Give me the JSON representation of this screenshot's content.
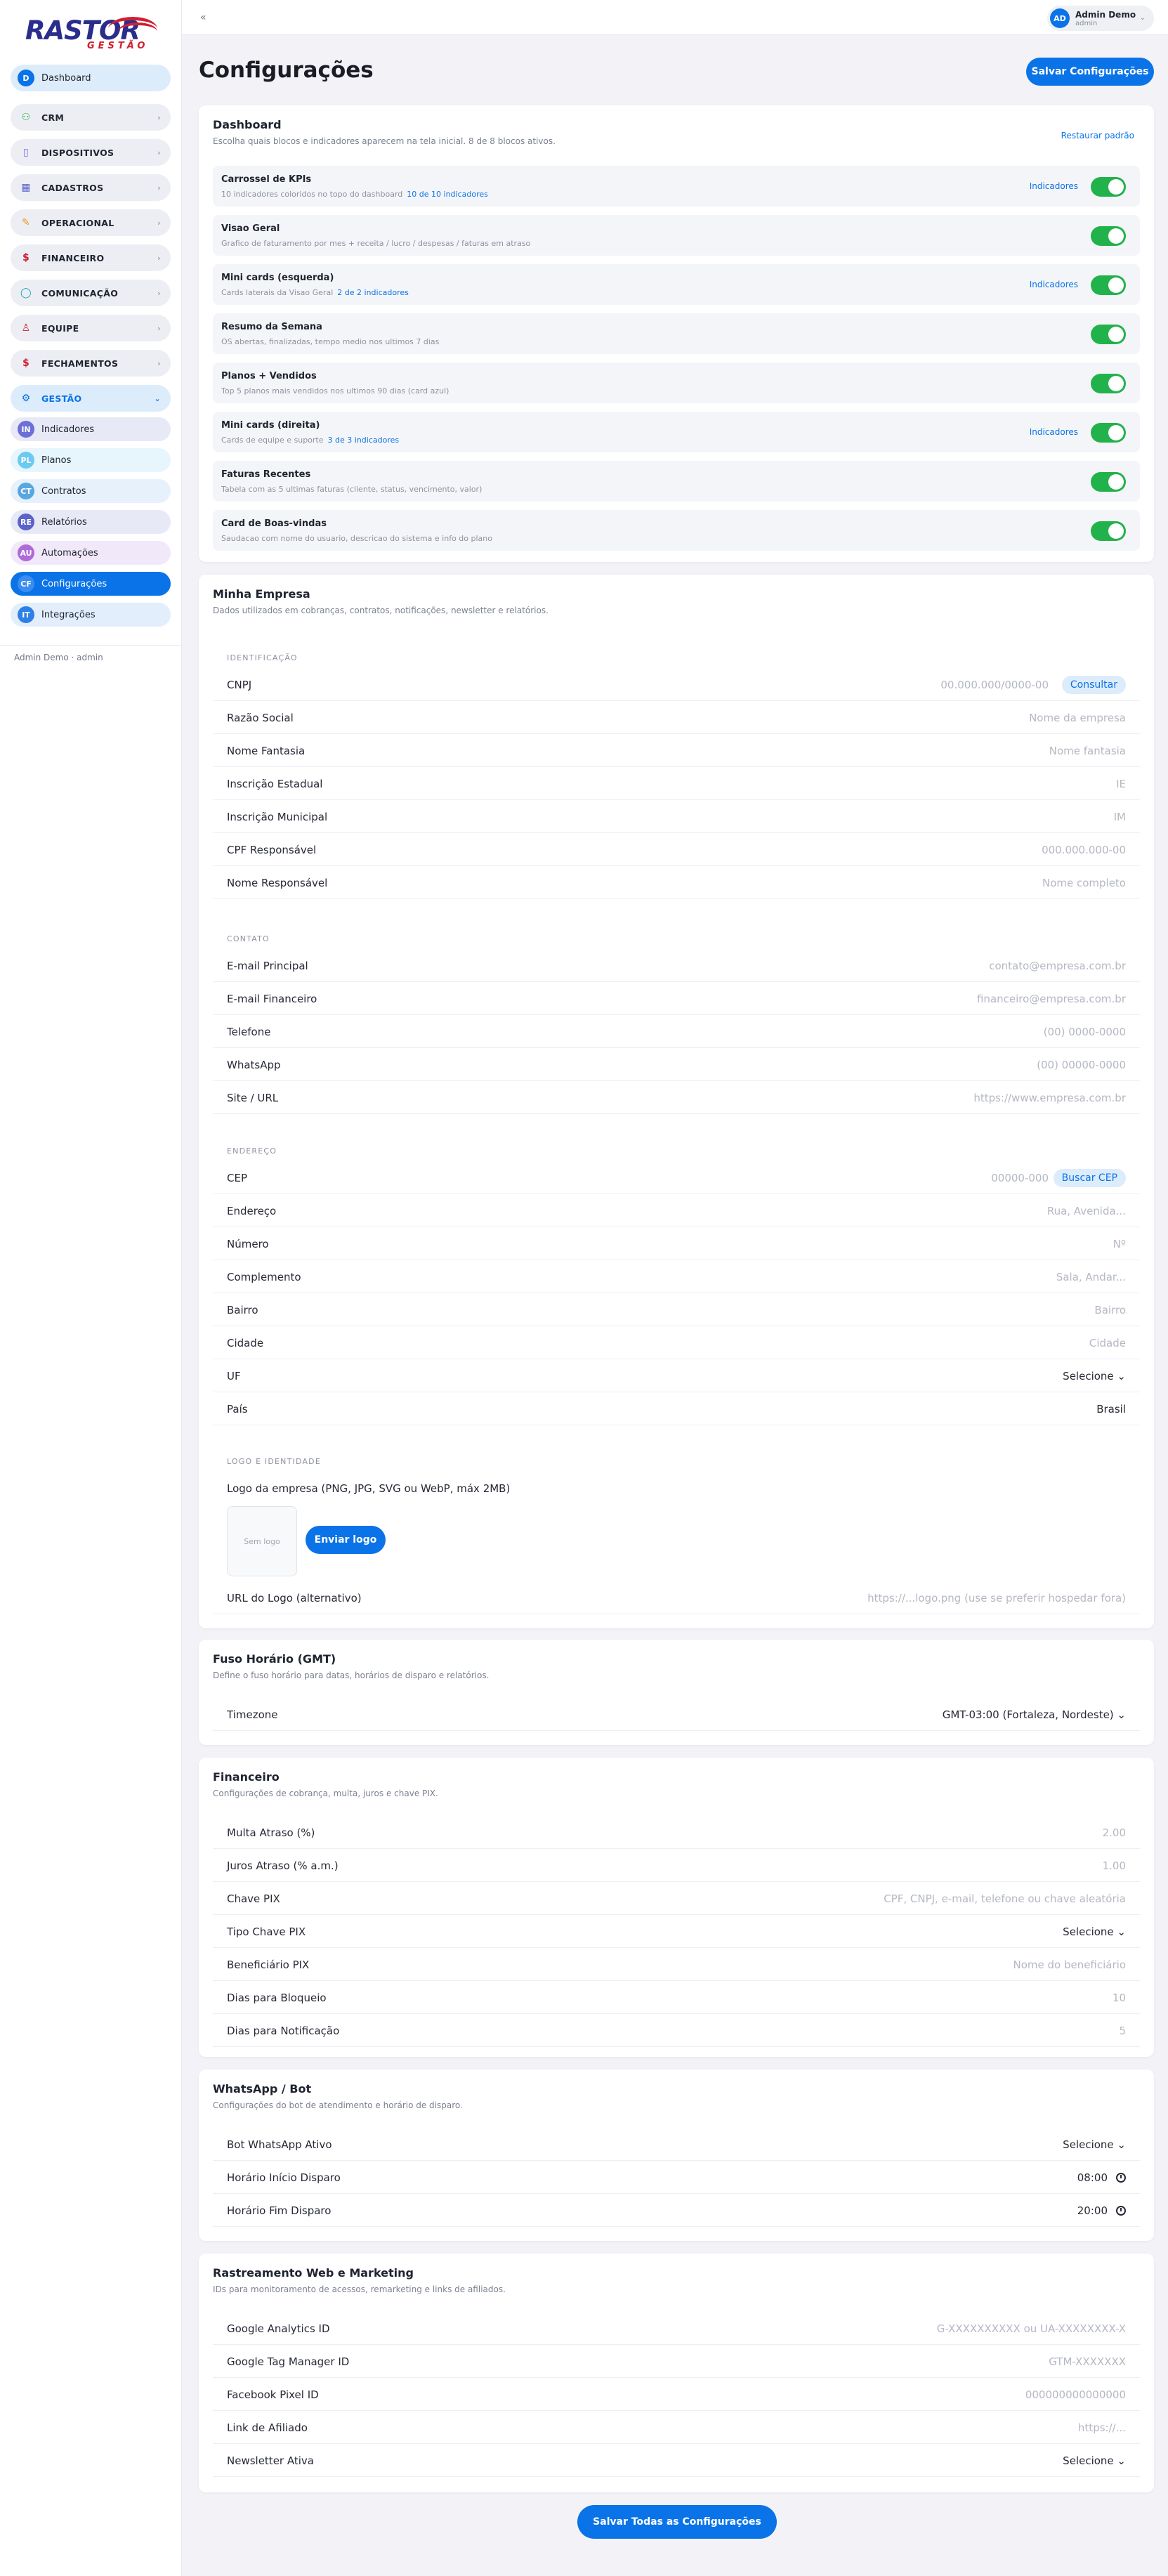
{
  "brand": {
    "name": "RASTOR",
    "sub": "GESTÃO"
  },
  "user": {
    "initials": "AD",
    "name": "Admin Demo",
    "role": "admin"
  },
  "sidebar": {
    "items": [
      {
        "label": "Dashboard",
        "icon": "D"
      },
      {
        "label": "CRM",
        "icon": "users-icon"
      },
      {
        "label": "DISPOSITIVOS",
        "icon": "device-icon"
      },
      {
        "label": "CADASTROS",
        "icon": "grid-icon"
      },
      {
        "label": "OPERACIONAL",
        "icon": "pencil-icon"
      },
      {
        "label": "FINANCEIRO",
        "icon": "dollar-icon"
      },
      {
        "label": "COMUNICAÇÃO",
        "icon": "chat-icon"
      },
      {
        "label": "EQUIPE",
        "icon": "person-icon"
      },
      {
        "label": "FECHAMENTOS",
        "icon": "dollar-icon"
      },
      {
        "label": "GESTÃO",
        "icon": "gear-icon"
      }
    ],
    "sub": [
      {
        "label": "Indicadores",
        "icon": "IN",
        "color": "#6b6fd6"
      },
      {
        "label": "Planos",
        "icon": "PL",
        "color": "#6ccaf0"
      },
      {
        "label": "Contratos",
        "icon": "CT",
        "color": "#5aa7e0"
      },
      {
        "label": "Relatórios",
        "icon": "RE",
        "color": "#5b63c8"
      },
      {
        "label": "Automações",
        "icon": "AU",
        "color": "#b06ad9"
      },
      {
        "label": "Configurações",
        "icon": "CF",
        "color": "#3a8df0"
      },
      {
        "label": "Integrações",
        "icon": "IT",
        "color": "#2e7fe6"
      }
    ],
    "footer": "Admin Demo · admin"
  },
  "page": {
    "title": "Configurações",
    "save_top": "Salvar Configurações",
    "save_bottom": "Salvar Todas as Configurações"
  },
  "dashboard": {
    "title": "Dashboard",
    "subtitle": "Escolha quais blocos e indicadores aparecem na tela inicial. 8 de 8 blocos ativos.",
    "restore": "Restaurar padrão",
    "rows": [
      {
        "title": "Carrossel de KPIs",
        "desc": "10 indicadores coloridos no topo do dashboard",
        "link": "10 de 10 indicadores",
        "ind": "Indicadores"
      },
      {
        "title": "Visao Geral",
        "desc": "Grafico de faturamento por mes + receita / lucro / despesas / faturas em atraso",
        "link": "",
        "ind": ""
      },
      {
        "title": "Mini cards (esquerda)",
        "desc": "Cards laterais da Visao Geral",
        "link": "2 de 2 indicadores",
        "ind": "Indicadores"
      },
      {
        "title": "Resumo da Semana",
        "desc": "OS abertas, finalizadas, tempo medio nos ultimos 7 dias",
        "link": "",
        "ind": ""
      },
      {
        "title": "Planos + Vendidos",
        "desc": "Top 5 planos mais vendidos nos ultimos 90 dias (card azul)",
        "link": "",
        "ind": ""
      },
      {
        "title": "Mini cards (direita)",
        "desc": "Cards de equipe e suporte",
        "link": "3 de 3 indicadores",
        "ind": "Indicadores"
      },
      {
        "title": "Faturas Recentes",
        "desc": "Tabela com as 5 ultimas faturas (cliente, status, vencimento, valor)",
        "link": "",
        "ind": ""
      },
      {
        "title": "Card de Boas-vindas",
        "desc": "Saudacao com nome do usuario, descricao do sistema e info do plano",
        "link": "",
        "ind": ""
      }
    ]
  },
  "empresa": {
    "title": "Minha Empresa",
    "subtitle": "Dados utilizados em cobranças, contratos, notificações, newsletter e relatórios.",
    "sec_id": "IDENTIFICAÇÃO",
    "sec_contato": "CONTATO",
    "sec_endereco": "ENDEREÇO",
    "sec_logo": "LOGO E IDENTIDADE",
    "ident": [
      {
        "label": "CNPJ",
        "ph": "00.000.000/0000-00",
        "btn": "Consultar"
      },
      {
        "label": "Razão Social",
        "ph": "Nome da empresa"
      },
      {
        "label": "Nome Fantasia",
        "ph": "Nome fantasia"
      },
      {
        "label": "Inscrição Estadual",
        "ph": "IE"
      },
      {
        "label": "Inscrição Municipal",
        "ph": "IM"
      },
      {
        "label": "CPF Responsável",
        "ph": "000.000.000-00"
      },
      {
        "label": "Nome Responsável",
        "ph": "Nome completo"
      }
    ],
    "contato": [
      {
        "label": "E-mail Principal",
        "ph": "contato@empresa.com.br"
      },
      {
        "label": "E-mail Financeiro",
        "ph": "financeiro@empresa.com.br"
      },
      {
        "label": "Telefone",
        "ph": "(00) 0000-0000"
      },
      {
        "label": "WhatsApp",
        "ph": "(00) 00000-0000"
      },
      {
        "label": "Site / URL",
        "ph": "https://www.empresa.com.br"
      }
    ],
    "endereco": [
      {
        "label": "CEP",
        "ph": "00000-000",
        "btn": "Buscar CEP"
      },
      {
        "label": "Endereço",
        "ph": "Rua, Avenida..."
      },
      {
        "label": "Número",
        "ph": "Nº"
      },
      {
        "label": "Complemento",
        "ph": "Sala, Andar..."
      },
      {
        "label": "Bairro",
        "ph": "Bairro"
      },
      {
        "label": "Cidade",
        "ph": "Cidade"
      },
      {
        "label": "UF",
        "val": "Selecione"
      },
      {
        "label": "País",
        "val": "Brasil"
      }
    ],
    "logo_label": "Logo da empresa (PNG, JPG, SVG ou WebP, máx 2MB)",
    "no_logo": "Sem logo",
    "upload": "Enviar logo",
    "logo_url_label": "URL do Logo (alternativo)",
    "logo_url_ph": "https://...logo.png (use se preferir hospedar fora)"
  },
  "fuso": {
    "title": "Fuso Horário (GMT)",
    "subtitle": "Define o fuso horário para datas, horários de disparo e relatórios.",
    "label": "Timezone",
    "val": "GMT-03:00 (Fortaleza, Nordeste)"
  },
  "financeiro": {
    "title": "Financeiro",
    "subtitle": "Configurações de cobrança, multa, juros e chave PIX.",
    "rows": [
      {
        "label": "Multa Atraso (%)",
        "ph": "2.00"
      },
      {
        "label": "Juros Atraso (% a.m.)",
        "ph": "1.00"
      },
      {
        "label": "Chave PIX",
        "ph": "CPF, CNPJ, e-mail, telefone ou chave aleatória"
      },
      {
        "label": "Tipo Chave PIX",
        "val": "Selecione"
      },
      {
        "label": "Beneficiário PIX",
        "ph": "Nome do beneficiário"
      },
      {
        "label": "Dias para Bloqueio",
        "ph": "10"
      },
      {
        "label": "Dias para Notificação",
        "ph": "5"
      }
    ]
  },
  "whatsapp": {
    "title": "WhatsApp / Bot",
    "subtitle": "Configurações do bot de atendimento e horário de disparo.",
    "rows": [
      {
        "label": "Bot WhatsApp Ativo",
        "val": "Selecione"
      },
      {
        "label": "Horário Início Disparo",
        "val": "08:00"
      },
      {
        "label": "Horário Fim Disparo",
        "val": "20:00"
      }
    ]
  },
  "rastreamento": {
    "title": "Rastreamento Web e Marketing",
    "subtitle": "IDs para monitoramento de acessos, remarketing e links de afiliados.",
    "rows": [
      {
        "label": "Google Analytics ID",
        "ph": "G-XXXXXXXXXX ou UA-XXXXXXXX-X"
      },
      {
        "label": "Google Tag Manager ID",
        "ph": "GTM-XXXXXXX"
      },
      {
        "label": "Facebook Pixel ID",
        "ph": "000000000000000"
      },
      {
        "label": "Link de Afiliado",
        "ph": "https://..."
      },
      {
        "label": "Newsletter Ativa",
        "val": "Selecione"
      }
    ]
  }
}
